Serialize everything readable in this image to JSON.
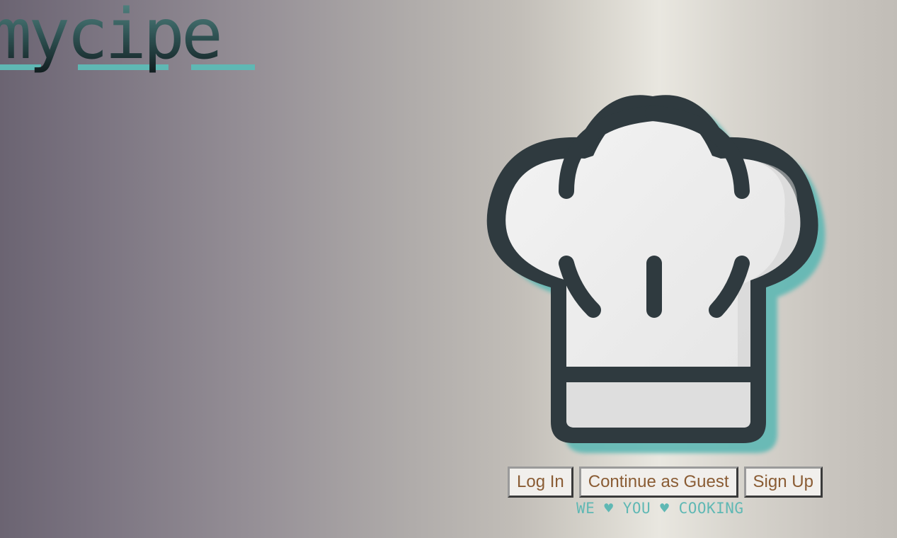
{
  "logo": {
    "text": "mycipe"
  },
  "hero": {
    "image": "chef-hat-icon"
  },
  "actions": {
    "login_label": "Log In",
    "guest_label": "Continue as Guest",
    "signup_label": "Sign Up"
  },
  "tagline": "WE ♥ YOU ♥ COOKING",
  "colors": {
    "accent_teal": "#5fb8b4",
    "button_text": "#8a5c34",
    "hat_outline": "#2f3a3f",
    "hat_fill": "#ececec"
  }
}
